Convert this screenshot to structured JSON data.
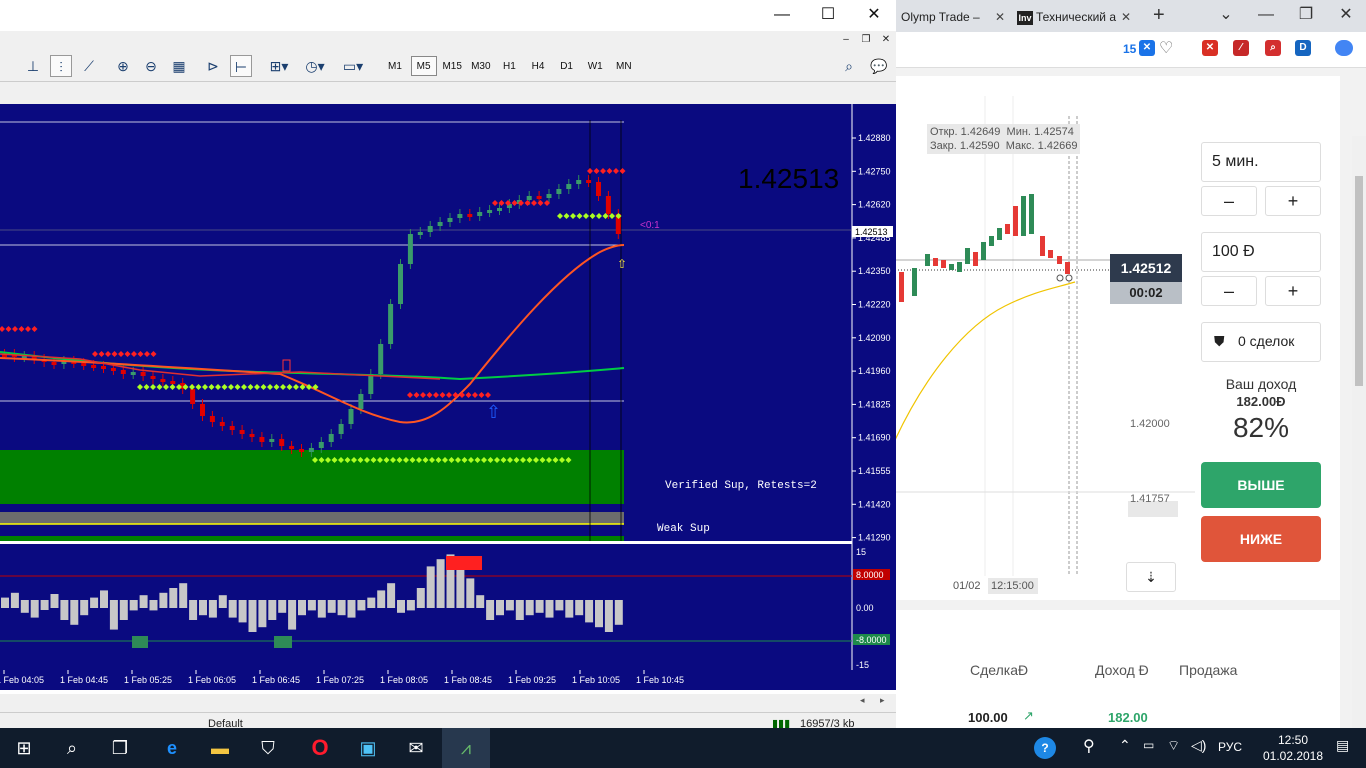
{
  "browser": {
    "tabs": [
      {
        "label": "Olymp Trade –"
      },
      {
        "label": "Технический а",
        "favicon": "Inv"
      }
    ],
    "badge_count": "15"
  },
  "olymp": {
    "ohlc": {
      "open_label": "Откр.",
      "open": "1.42649",
      "low_label": "Мин.",
      "low": "1.42574",
      "close_label": "Закр.",
      "close": "1.42590",
      "high_label": "Макс.",
      "high": "1.42669"
    },
    "price_levels": [
      "1.42000",
      "1.41757"
    ],
    "x_labels": [
      "01/02",
      "12:15:00"
    ],
    "current_price": "1.42512",
    "countdown": "00:02",
    "duration": "5 мин.",
    "amount": "100 Đ",
    "minus": "–",
    "plus": "+",
    "deals": "0 сделок",
    "income_label": "Ваш доход",
    "income_value": "182.00Đ",
    "income_percent": "82%",
    "up_button": "ВЫШЕ",
    "down_button": "НИЖЕ",
    "table": {
      "headers": [
        "СделкаĐ",
        "Доход Đ",
        "Продажа"
      ],
      "row": {
        "deal": "100.00",
        "income": "182.00"
      }
    }
  },
  "mt4": {
    "timeframes": [
      "M1",
      "M5",
      "M15",
      "M30",
      "H1",
      "H4",
      "D1",
      "W1",
      "MN"
    ],
    "active_timeframe": "M5",
    "big_price": "1.42513",
    "price_axis": [
      "1.42880",
      "1.42750",
      "1.42620",
      "1.42485",
      "1.42350",
      "1.42220",
      "1.42090",
      "1.41960",
      "1.41825",
      "1.41690",
      "1.41555",
      "1.41420",
      "1.41290"
    ],
    "bid_label": "1.42513",
    "zone_label_1": "Verified Sup, Retests=2",
    "zone_label_2": "Weak Sup",
    "marker_label": "<0:1",
    "osc_axis": [
      "15",
      "8.0000",
      "0.00",
      "-8.0000",
      "-15"
    ],
    "time_axis": [
      "1 Feb 04:05",
      "1 Feb 04:45",
      "1 Feb 05:25",
      "1 Feb 06:05",
      "1 Feb 06:45",
      "1 Feb 07:25",
      "1 Feb 08:05",
      "1 Feb 08:45",
      "1 Feb 09:25",
      "1 Feb 10:05",
      "1 Feb 10:45"
    ],
    "status_profile": "Default",
    "status_traffic": "16957/3 kb"
  },
  "taskbar": {
    "lang": "РУС",
    "time": "12:50",
    "date": "01.02.2018"
  },
  "colors": {
    "chart_bg": "#0a0a80",
    "bull": "#2e8b57",
    "bear": "#e00000",
    "zone": "#008000",
    "up_button": "#2ea56a",
    "down_button": "#e0553a"
  }
}
